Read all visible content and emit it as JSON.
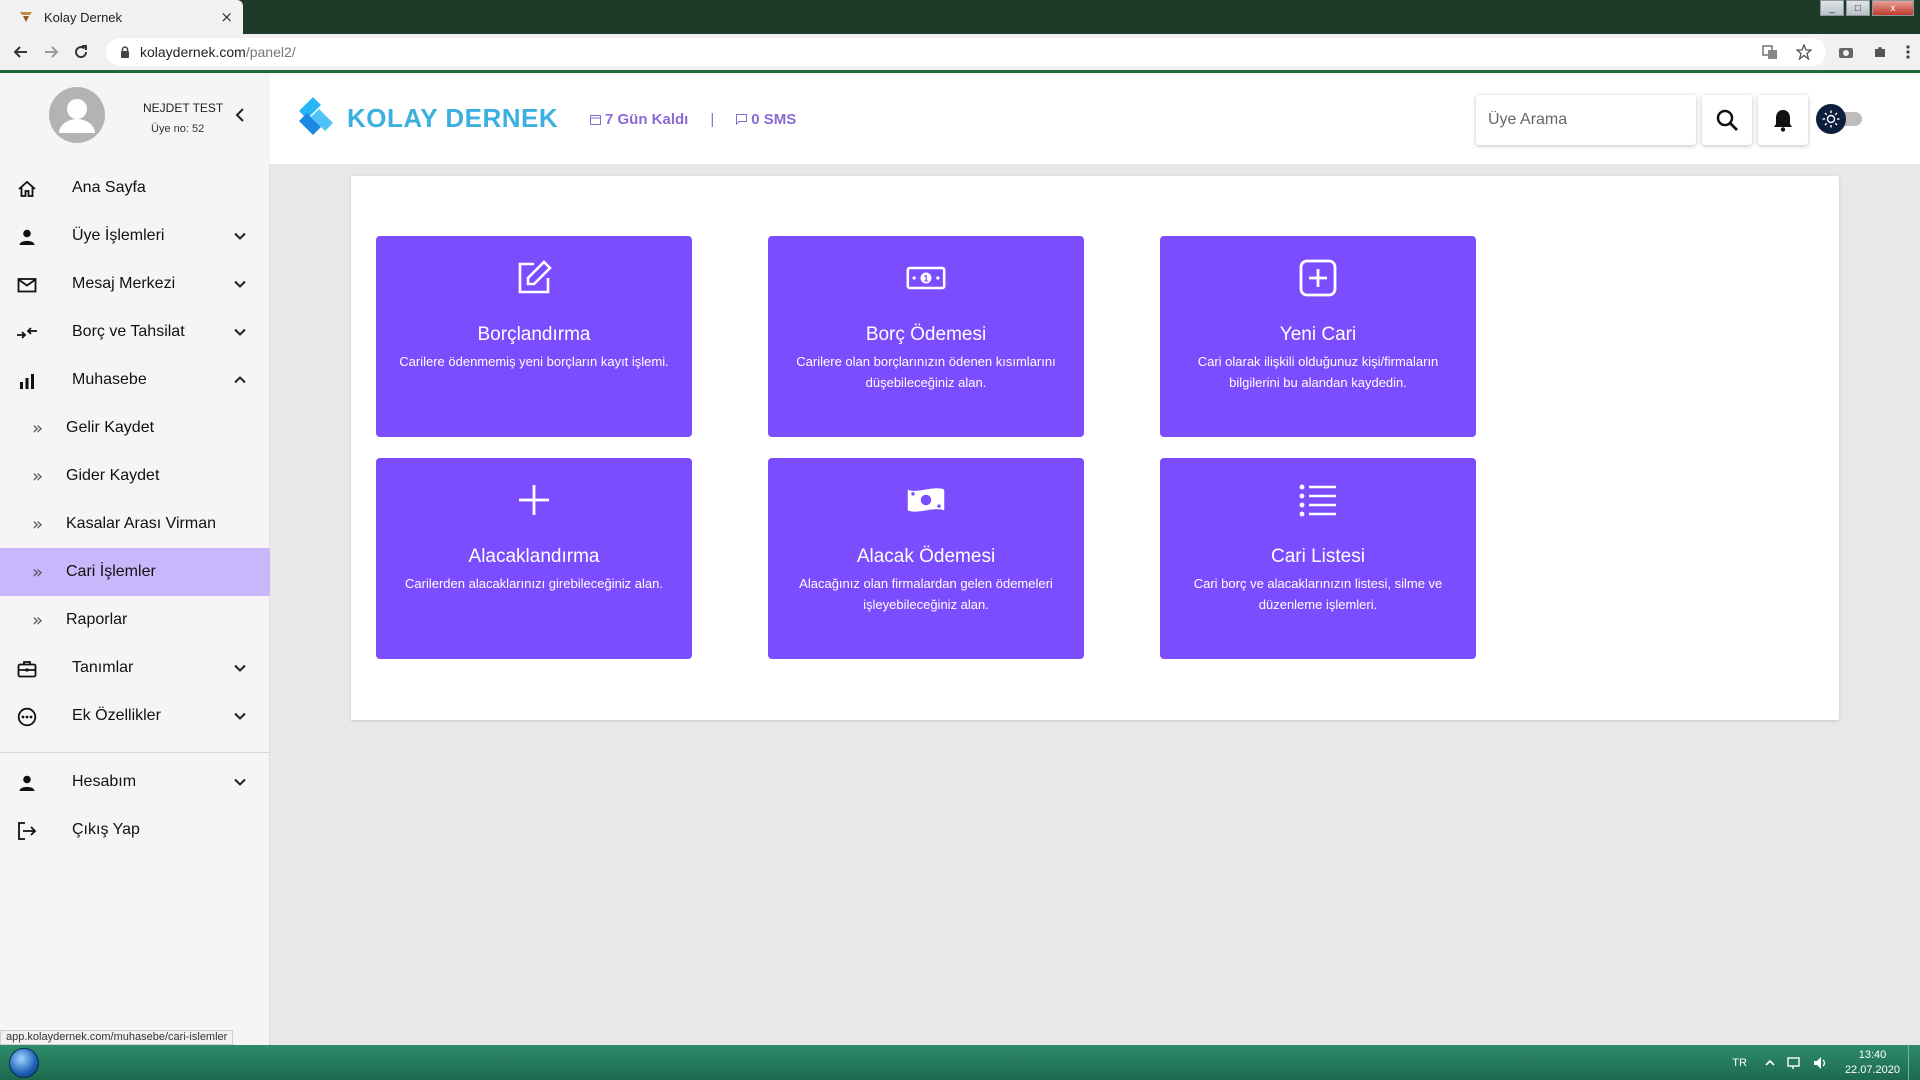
{
  "browser": {
    "tab_title": "Kolay Dernek",
    "tab_close": "×",
    "url_host": "kolaydernek.com",
    "url_path": "/panel2/",
    "status_url": "app.kolaydernek.com/muhasebe/cari-islemler"
  },
  "header": {
    "user_name": "NEJDET TEST",
    "user_no": "Üye no: 52",
    "logo_text": "KOLAY DERNEK",
    "days_left": "7 Gün Kaldı",
    "separator": "|",
    "sms": "0 SMS",
    "search_placeholder": "Üye Arama"
  },
  "sidebar": {
    "items": [
      {
        "label": "Ana Sayfa"
      },
      {
        "label": "Üye İşlemleri"
      },
      {
        "label": "Mesaj Merkezi"
      },
      {
        "label": "Borç ve Tahsilat"
      },
      {
        "label": "Muhasebe"
      },
      {
        "label": "Gelir Kaydet"
      },
      {
        "label": "Gider Kaydet"
      },
      {
        "label": "Kasalar Arası Virman"
      },
      {
        "label": "Cari İşlemler"
      },
      {
        "label": "Raporlar"
      },
      {
        "label": "Tanımlar"
      },
      {
        "label": "Ek Özellikler"
      },
      {
        "label": "Hesabım"
      },
      {
        "label": "Çıkış Yap"
      }
    ],
    "sub_arrow": "»",
    "active_item": "Cari İşlemler"
  },
  "tiles": [
    {
      "icon": "edit-icon",
      "title": "Borçlandırma",
      "desc": "Carilere ödenmemiş yeni borçların kayıt işlemi."
    },
    {
      "icon": "money-icon",
      "title": "Borç Ödemesi",
      "desc": "Carilere olan borçlarınızın ödenen kısımlarını düşebileceğiniz alan."
    },
    {
      "icon": "plus-box-icon",
      "title": "Yeni Cari",
      "desc": "Cari olarak ilişkili olduğunuz kişi/firmaların bilgilerini bu alandan kaydedin."
    },
    {
      "icon": "plus-icon",
      "title": "Alacaklandırma",
      "desc": "Carilerden alacaklarınızı girebileceğiniz alan."
    },
    {
      "icon": "cash-icon",
      "title": "Alacak Ödemesi",
      "desc": "Alacağınız olan firmalardan gelen ödemeleri işleyebileceğiniz alan."
    },
    {
      "icon": "list-icon",
      "title": "Cari Listesi",
      "desc": "Cari borç ve alacaklarınızın listesi, silme ve düzenleme işlemleri."
    }
  ],
  "taskbar": {
    "lang": "TR",
    "time": "13:40",
    "date": "22.07.2020"
  },
  "colors": {
    "tile": "#7c4dff",
    "active_menu": "#c8b8fb",
    "logo": "#3bb0e0",
    "header_info": "#8a6bd6",
    "taskbar": "#2f8c6a"
  }
}
